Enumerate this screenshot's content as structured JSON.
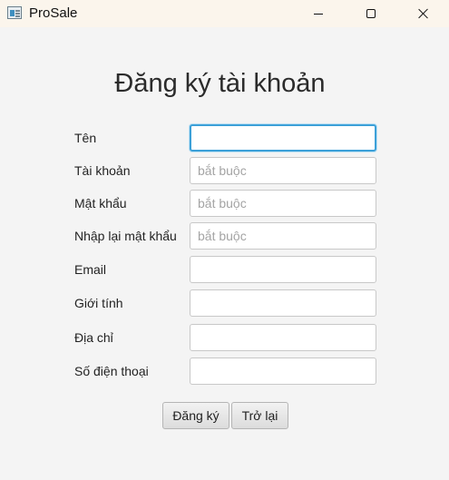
{
  "window": {
    "title": "ProSale"
  },
  "form": {
    "heading": "Đăng ký tài khoản",
    "fields": [
      {
        "label": "Tên",
        "value": "",
        "placeholder": ""
      },
      {
        "label": "Tài khoản",
        "value": "",
        "placeholder": "bắt buộc"
      },
      {
        "label": "Mật khẩu",
        "value": "",
        "placeholder": "bắt buộc"
      },
      {
        "label": "Nhập lại mật khẩu",
        "value": "",
        "placeholder": "bắt buộc"
      },
      {
        "label": "Email",
        "value": "",
        "placeholder": ""
      },
      {
        "label": "Giới tính",
        "value": "",
        "placeholder": ""
      },
      {
        "label": "Địa chỉ",
        "value": "",
        "placeholder": ""
      },
      {
        "label": "Số điện thoại",
        "value": "",
        "placeholder": ""
      }
    ],
    "register_label": "Đăng ký",
    "back_label": "Trở lại"
  },
  "colors": {
    "focus_ring": "#3ca0d8",
    "titlebar": "#fbf5ec",
    "background": "#f4f4f4"
  },
  "icons": {
    "app": "app-window-icon",
    "minimize": "minimize-icon",
    "maximize": "maximize-icon",
    "close": "close-icon"
  }
}
